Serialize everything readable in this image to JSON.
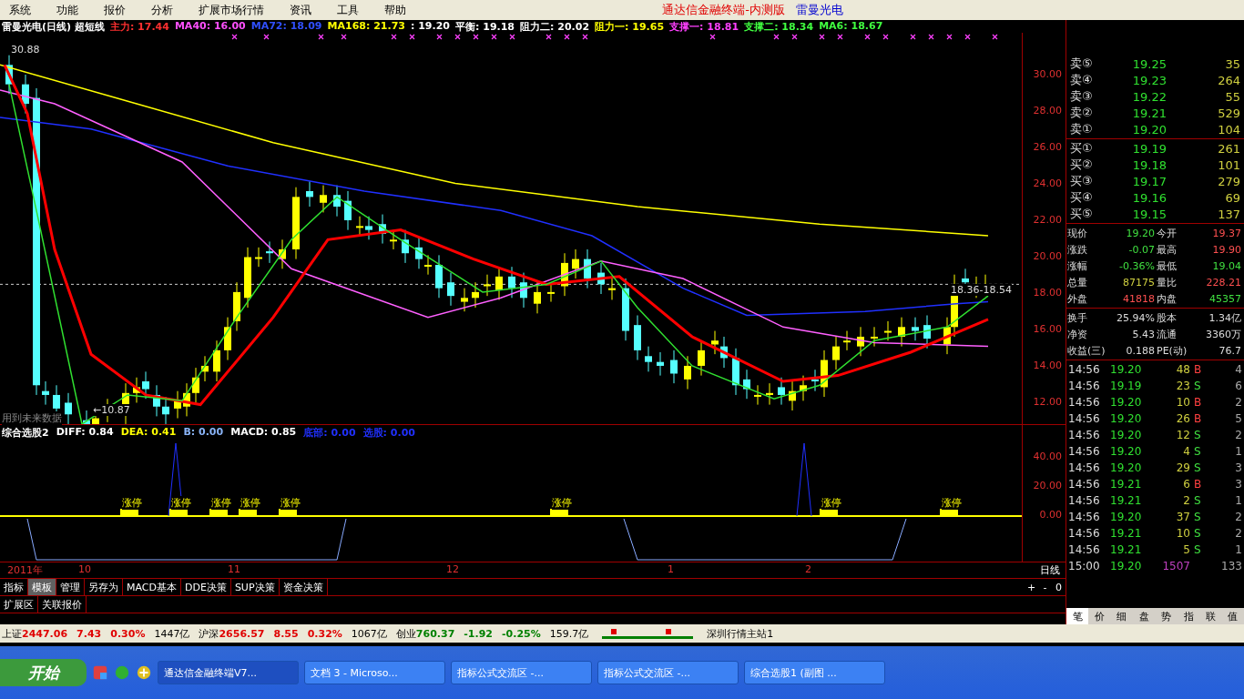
{
  "menu": [
    "系统",
    "功能",
    "报价",
    "分析",
    "扩展市场行情",
    "资讯",
    "工具",
    "帮助"
  ],
  "title_right": {
    "app": "通达信金融终端-内测版",
    "stock": "雷曼光电"
  },
  "info_line": [
    {
      "text": "雷曼光电(日线) 超短线",
      "color": "#ffffff"
    },
    {
      "text": "主力: 17.44",
      "color": "#ff3030"
    },
    {
      "text": "MA40: 16.00",
      "color": "#ff50ff"
    },
    {
      "text": "MA72: 18.09",
      "color": "#3050ff"
    },
    {
      "text": "MA168: 21.73",
      "color": "#ffff00"
    },
    {
      "text": ": 19.20",
      "color": "#ffffff"
    },
    {
      "text": "平衡: 19.18",
      "color": "#ffffff"
    },
    {
      "text": "阻力二: 20.02",
      "color": "#ffffff"
    },
    {
      "text": "阻力一: 19.65",
      "color": "#ffff00"
    },
    {
      "text": "支撑一: 18.81",
      "color": "#ff40ff"
    },
    {
      "text": "支撑二: 18.34",
      "color": "#40ff40"
    },
    {
      "text": "MA6: 18.67",
      "color": "#40ff40"
    }
  ],
  "price_axis": [
    "30.00",
    "28.00",
    "26.00",
    "24.00",
    "22.00",
    "20.00",
    "18.00",
    "16.00",
    "14.00",
    "12.00"
  ],
  "chart_notes": {
    "high": "30.88",
    "low": "←10.87",
    "range": "18.36-18.54",
    "warning": "用到未来数据"
  },
  "indicator": {
    "header": [
      {
        "text": "综合选股2",
        "color": "#ffffff"
      },
      {
        "text": "DIFF: 0.84",
        "color": "#ffffff"
      },
      {
        "text": "DEA: 0.41",
        "color": "#ffff00"
      },
      {
        "text": "B: 0.00",
        "color": "#8ab4f8"
      },
      {
        "text": "MACD: 0.85",
        "color": "#ffffff"
      },
      {
        "text": "底部: 0.00",
        "color": "#2030ff"
      },
      {
        "text": "选股: 0.00",
        "color": "#2030ff"
      }
    ],
    "axis": [
      "40.00",
      "20.00",
      "0.00"
    ],
    "signals": [
      "涨停",
      "涨停",
      "涨停",
      "涨停",
      "涨停",
      "涨停",
      "涨停",
      "涨停"
    ]
  },
  "time_axis": {
    "labels": [
      "2011年",
      "10",
      "11",
      "12",
      "1",
      "2"
    ],
    "period": "日线"
  },
  "tabs": [
    {
      "label": "指标",
      "selected": false
    },
    {
      "label": "模板",
      "selected": true
    },
    {
      "label": "管理",
      "selected": false
    },
    {
      "label": "另存为",
      "selected": false
    },
    {
      "label": "MACD基本",
      "selected": false
    },
    {
      "label": "DDE决策",
      "selected": false
    },
    {
      "label": "SUP决策",
      "selected": false
    },
    {
      "label": "资金决策",
      "selected": false
    }
  ],
  "zoom_controls": [
    "+",
    "-",
    "0"
  ],
  "sub_tabs": [
    "扩展区",
    "关联报价"
  ],
  "order_book": {
    "sell": [
      {
        "label": "卖⑤",
        "price": "19.25",
        "volume": "35"
      },
      {
        "label": "卖④",
        "price": "19.23",
        "volume": "264"
      },
      {
        "label": "卖③",
        "price": "19.22",
        "volume": "55"
      },
      {
        "label": "卖②",
        "price": "19.21",
        "volume": "529"
      },
      {
        "label": "卖①",
        "price": "19.20",
        "volume": "104"
      }
    ],
    "buy": [
      {
        "label": "买①",
        "price": "19.19",
        "volume": "261"
      },
      {
        "label": "买②",
        "price": "19.18",
        "volume": "101"
      },
      {
        "label": "买③",
        "price": "19.17",
        "volume": "279"
      },
      {
        "label": "买④",
        "price": "19.16",
        "volume": "69"
      },
      {
        "label": "买⑤",
        "price": "19.15",
        "volume": "137"
      }
    ]
  },
  "quote": [
    [
      {
        "label": "现价",
        "value": "19.20",
        "color": "#40e040"
      },
      {
        "label": "今开",
        "value": "19.37",
        "color": "#ff5050"
      }
    ],
    [
      {
        "label": "涨跌",
        "value": "-0.07",
        "color": "#40e040"
      },
      {
        "label": "最高",
        "value": "19.90",
        "color": "#ff5050"
      }
    ],
    [
      {
        "label": "涨幅",
        "value": "-0.36%",
        "color": "#40e040"
      },
      {
        "label": "最低",
        "value": "19.04",
        "color": "#40e040"
      }
    ],
    [
      {
        "label": "总量",
        "value": "87175",
        "color": "#d0d040"
      },
      {
        "label": "量比",
        "value": "228.21",
        "color": "#ff5050"
      }
    ],
    [
      {
        "label": "外盘",
        "value": "41818",
        "color": "#ff5050"
      },
      {
        "label": "内盘",
        "value": "45357",
        "color": "#40e040"
      }
    ]
  ],
  "fundamentals": [
    [
      {
        "label": "换手",
        "value": "25.94%"
      },
      {
        "label": "股本",
        "value": "1.34亿"
      }
    ],
    [
      {
        "label": "净资",
        "value": "5.43"
      },
      {
        "label": "流通",
        "value": "3360万"
      }
    ],
    [
      {
        "label": "收益(三)",
        "value": "0.188"
      },
      {
        "label": "PE(动)",
        "value": "76.7"
      }
    ]
  ],
  "ticks": [
    {
      "time": "14:56",
      "price": "19.20",
      "volume": "48",
      "side": "B",
      "kind": "buy",
      "count": "4"
    },
    {
      "time": "14:56",
      "price": "19.19",
      "volume": "23",
      "side": "S",
      "kind": "sell",
      "count": "6"
    },
    {
      "time": "14:56",
      "price": "19.20",
      "volume": "10",
      "side": "B",
      "kind": "buy",
      "count": "2"
    },
    {
      "time": "14:56",
      "price": "19.20",
      "volume": "26",
      "side": "B",
      "kind": "buy",
      "count": "5"
    },
    {
      "time": "14:56",
      "price": "19.20",
      "volume": "12",
      "side": "S",
      "kind": "sell",
      "count": "2"
    },
    {
      "time": "14:56",
      "price": "19.20",
      "volume": "4",
      "side": "S",
      "kind": "sell",
      "count": "1"
    },
    {
      "time": "14:56",
      "price": "19.20",
      "volume": "29",
      "side": "S",
      "kind": "sell",
      "count": "3"
    },
    {
      "time": "14:56",
      "price": "19.21",
      "volume": "6",
      "side": "B",
      "kind": "buy",
      "count": "3"
    },
    {
      "time": "14:56",
      "price": "19.21",
      "volume": "2",
      "side": "S",
      "kind": "sell",
      "count": "1"
    },
    {
      "time": "14:56",
      "price": "19.20",
      "volume": "37",
      "side": "S",
      "kind": "sell",
      "count": "2"
    },
    {
      "time": "14:56",
      "price": "19.21",
      "volume": "10",
      "side": "S",
      "kind": "sell",
      "count": "2"
    },
    {
      "time": "14:56",
      "price": "19.21",
      "volume": "5",
      "side": "S",
      "kind": "sell",
      "count": "1"
    },
    {
      "time": "15:00",
      "price": "19.20",
      "volume": "1507",
      "kind": "close",
      "count": "133"
    }
  ],
  "panel_tabs": [
    {
      "label": "笔",
      "selected": true
    },
    {
      "label": "价",
      "selected": false
    },
    {
      "label": "细",
      "selected": false
    },
    {
      "label": "盘",
      "selected": false
    },
    {
      "label": "势",
      "selected": false
    },
    {
      "label": "指",
      "selected": false
    },
    {
      "label": "联",
      "selected": false
    },
    {
      "label": "值",
      "selected": false
    }
  ],
  "index_bar": [
    {
      "name": "上证",
      "value": "2447.06",
      "change": "7.43",
      "pct": "0.30%",
      "amount": "1447亿",
      "color": "#e00000"
    },
    {
      "name": "沪深",
      "value": "2656.57",
      "change": "8.55",
      "pct": "0.32%",
      "amount": "1067亿",
      "color": "#e00000"
    },
    {
      "name": "创业",
      "value": "760.37",
      "change": "-1.92",
      "pct": "-0.25%",
      "amount": "159.7亿",
      "color": "#008000"
    }
  ],
  "server": "深圳行情主站1",
  "taskbar": {
    "start": "开始",
    "tasks": [
      {
        "label": "通达信金融终端V7...",
        "selected": true
      },
      {
        "label": "文档 3 - Microso...",
        "selected": false
      },
      {
        "label": "指标公式交流区 -...",
        "selected": false
      },
      {
        "label": "指标公式交流区 -...",
        "selected": false
      },
      {
        "label": "综合选股1 (副图 ...",
        "selected": false
      }
    ]
  }
}
